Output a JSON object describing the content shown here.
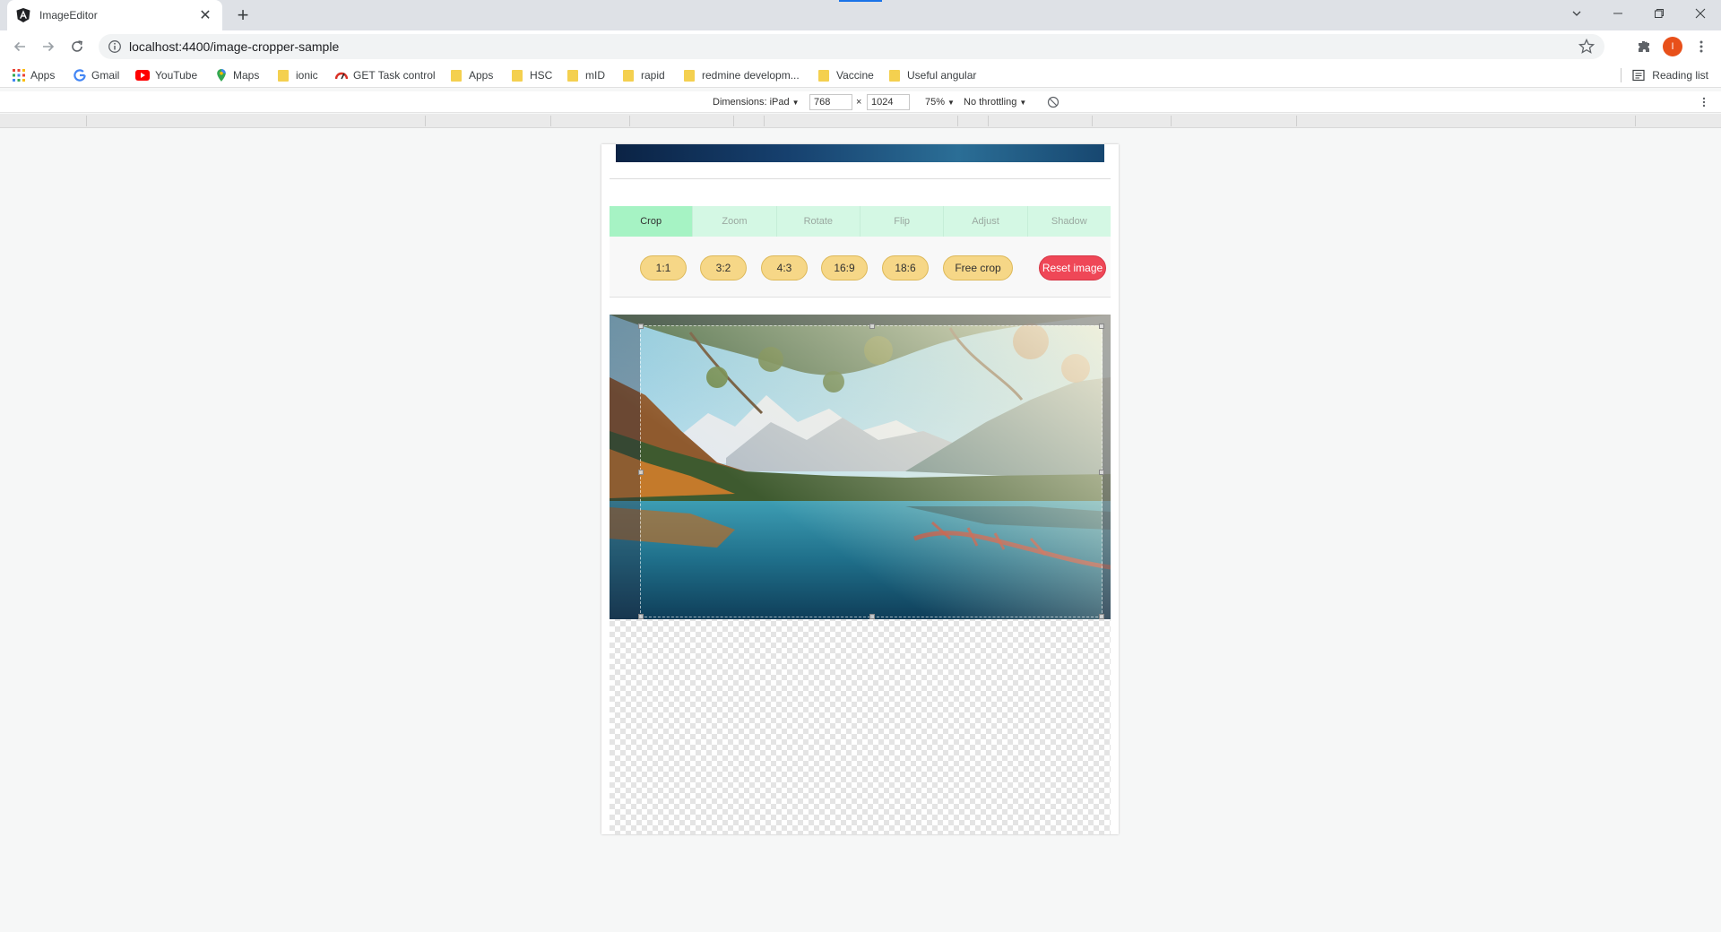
{
  "browser": {
    "tab_title": "ImageEditor",
    "url": "localhost:4400/image-cropper-sample",
    "avatar_letter": "I",
    "accent_color": "#1a73e8"
  },
  "bookmarks": {
    "items": [
      "Apps",
      "Gmail",
      "YouTube",
      "Maps",
      "ionic",
      "GET Task control",
      "Apps",
      "HSC",
      "mID",
      "rapid",
      "redmine developm...",
      "Vaccine",
      "Useful angular"
    ],
    "reading_list": "Reading list"
  },
  "devtools": {
    "dimensions_label": "Dimensions: iPad",
    "width": "768",
    "times": "×",
    "height": "1024",
    "zoom": "75%",
    "throttling": "No throttling"
  },
  "editor": {
    "tabs": [
      "Crop",
      "Zoom",
      "Rotate",
      "Flip",
      "Adjust",
      "Shadow"
    ],
    "active_tab": "Crop",
    "ratios": [
      "1:1",
      "3:2",
      "4:3",
      "16:9",
      "18:6",
      "Free crop"
    ],
    "reset_label": "Reset image",
    "tab_active_color": "#a6f3c4",
    "ratio_button_color": "#f6d787",
    "reset_color": "#ef4757"
  },
  "icons": [
    "angular-favicon",
    "close-icon",
    "new-tab-icon",
    "back-icon",
    "forward-icon",
    "reload-icon",
    "info-icon",
    "star-icon",
    "extensions-icon",
    "menu-icon",
    "apps-grid-icon",
    "google-icon",
    "youtube-icon",
    "maps-icon",
    "task-control-icon",
    "folder-icon",
    "reading-list-icon",
    "rotate-device-icon"
  ]
}
